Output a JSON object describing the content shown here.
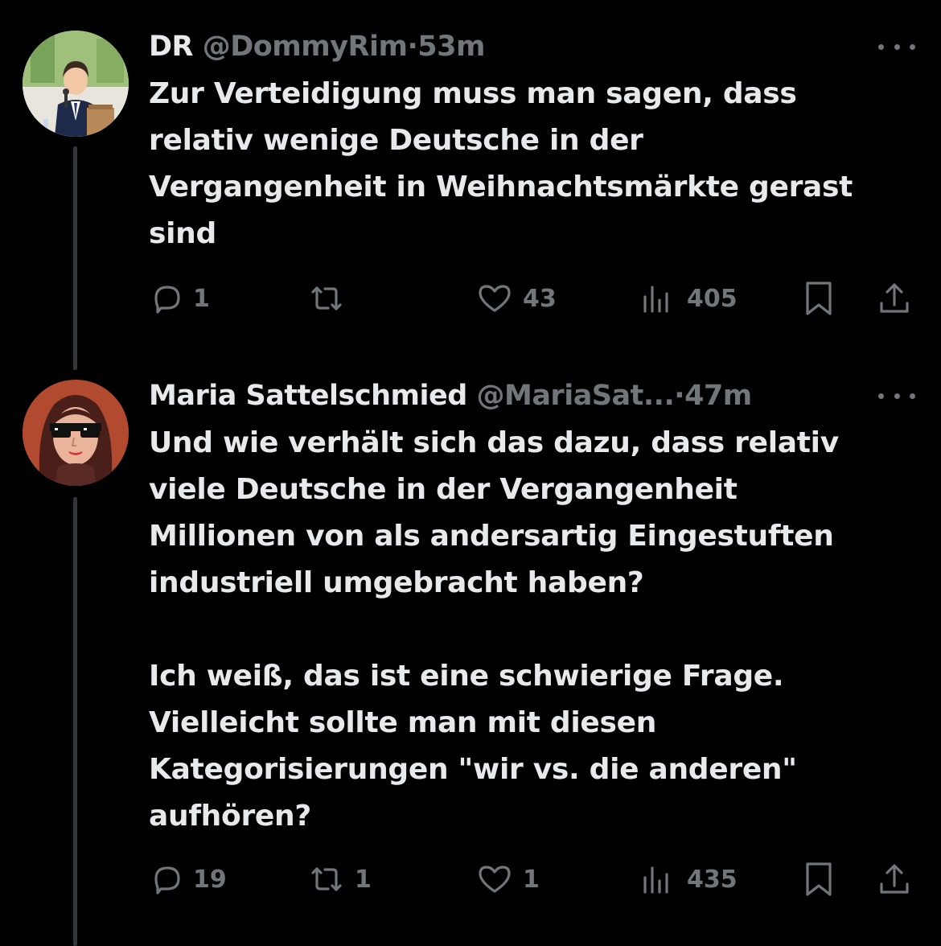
{
  "tweets": [
    {
      "display_name": "DR",
      "handle": "@DommyRim",
      "separator": "·",
      "time": "53m",
      "text": "Zur Verteidigung muss man sagen, dass\nrelativ wenige Deutsche in der\nVergangenheit in Weihnachtsmärkte gerast\nsind",
      "replies": "1",
      "reposts": "",
      "likes": "43",
      "views": "405",
      "avatar_icon": "avatar-man-suit-microphone"
    },
    {
      "display_name": "Maria Sattelschmied",
      "handle": "@MariaSat...",
      "separator": "·",
      "time": "47m",
      "text": "Und wie verhält sich das dazu, dass relativ\nviele Deutsche in der Vergangenheit\nMillionen von als andersartig Eingestuften\nindustriell umgebracht haben?\n\nIch weiß, das ist eine schwierige Frage.\nVielleicht sollte man mit diesen\nKategorisierungen \"wir vs. die anderen\"\naufhören?",
      "replies": "19",
      "reposts": "1",
      "likes": "1",
      "views": "435",
      "avatar_icon": "avatar-woman-sunglasses"
    }
  ],
  "colors": {
    "background": "#000000",
    "text_primary": "#e7e9ea",
    "text_secondary": "#71767b",
    "thread_line": "#333639"
  },
  "icons": [
    "reply-icon",
    "repost-icon",
    "like-icon",
    "views-icon",
    "bookmark-icon",
    "share-icon",
    "more-icon"
  ]
}
